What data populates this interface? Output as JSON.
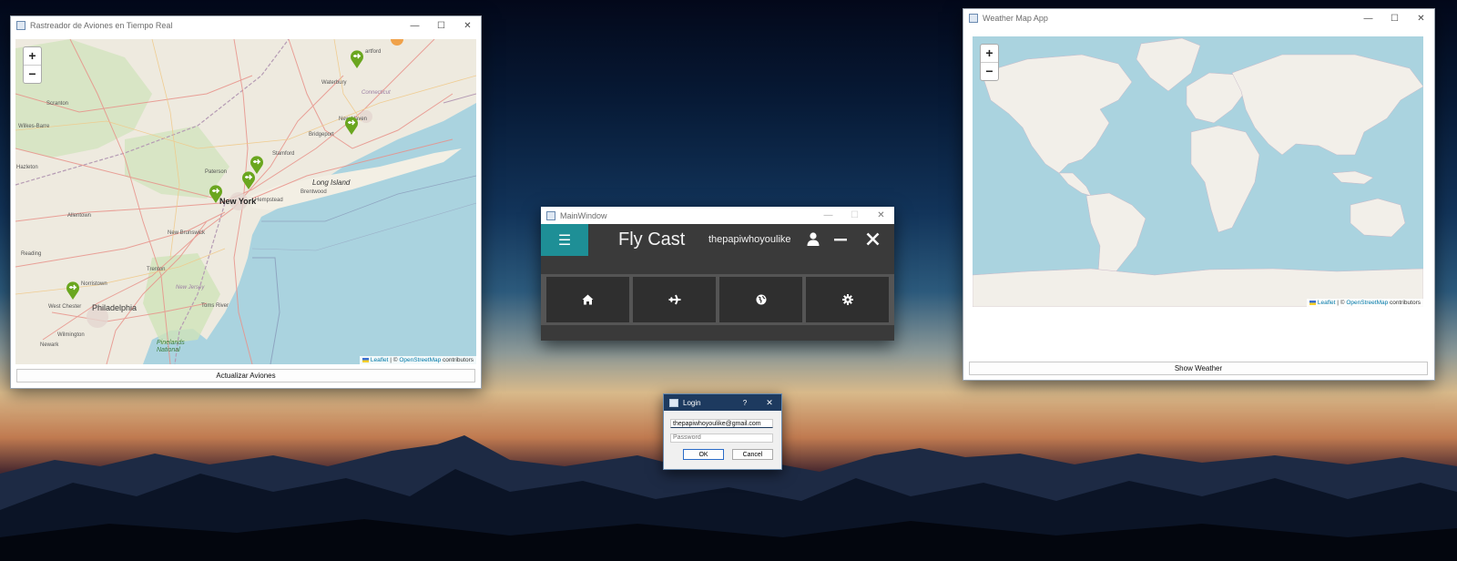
{
  "desktop": {
    "wallpaper": "mountains-at-dusk"
  },
  "plane_tracker": {
    "title": "Rastreador de Aviones en Tiempo Real",
    "zoom_in": "+",
    "zoom_out": "−",
    "attribution_leaflet": "Leaflet",
    "attribution_sep": " | © ",
    "attribution_osm": "OpenStreetMap",
    "attribution_tail": " contributors",
    "update_button": "Actualizar Aviones",
    "places": {
      "waterbury": "Waterbury",
      "hartford": "artford",
      "connecticut": "Connecticut",
      "bridgeport": "Bridgeport",
      "new_haven": "New Haven",
      "stamford": "Stamford",
      "wilkes_barre": "Wilkes-Barre",
      "hazleton": "Hazleton",
      "scranton": "Scranton",
      "paterson": "Paterson",
      "new_york": "New York",
      "hempstead": "Hempstead",
      "brentwood": "Brentwood",
      "long_island": "Long Island",
      "allentown": "Allentown",
      "new_brunswick": "New Brunswick",
      "trenton": "Trenton",
      "new_jersey": "New Jersey",
      "toms_river": "Toms River",
      "reading": "Reading",
      "norristown": "Norristown",
      "west_chester": "West Chester",
      "philadelphia": "Philadelphia",
      "wilmington": "Wilmington",
      "newark_de": "Newark",
      "pinelands": "Pinelands\nNational"
    }
  },
  "weather_app": {
    "title": "Weather Map App",
    "zoom_in": "+",
    "zoom_out": "−",
    "attribution_leaflet": "Leaflet",
    "attribution_sep": " | © ",
    "attribution_osm": "OpenStreetMap",
    "attribution_tail": " contributors",
    "show_button": "Show Weather"
  },
  "flycast": {
    "window_title": "MainWindow",
    "app_title": "Fly Cast",
    "username": "thepapiwhoyoulike",
    "menu_icon": "hamburger-icon",
    "tiles": [
      {
        "name": "home",
        "icon": "home-icon"
      },
      {
        "name": "flights",
        "icon": "airplane-icon"
      },
      {
        "name": "globe",
        "icon": "globe-icon"
      },
      {
        "name": "settings",
        "icon": "gear-icon"
      }
    ],
    "accent": "#1e8f96"
  },
  "login": {
    "title": "Login",
    "help": "?",
    "email_value": "thepapiwhoyoulike@gmail.com",
    "password_placeholder": "Password",
    "ok": "OK",
    "cancel": "Cancel"
  },
  "colors": {
    "marker_green": "#6aa61f",
    "water": "#aad3df",
    "land": "#f2efe9",
    "titlebar_blue": "#1d3a5f"
  }
}
